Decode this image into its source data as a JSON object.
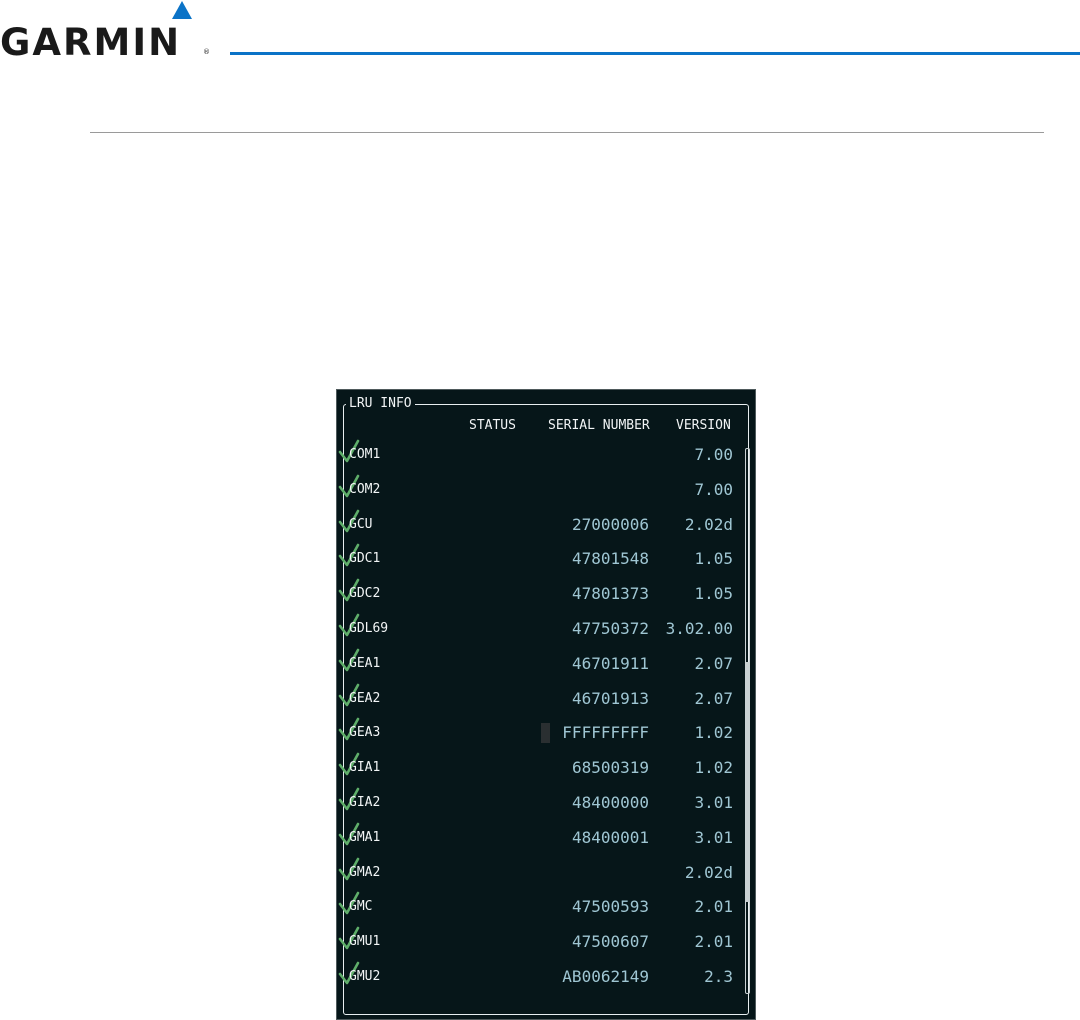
{
  "brand": {
    "name": "GARMIN",
    "mark": "®",
    "logo_color": "#0b73c7"
  },
  "panel": {
    "title": "LRU INFO",
    "columns": {
      "status": "STATUS",
      "serial": "SERIAL NUMBER",
      "version": "VERSION"
    },
    "status_icon": "check-mark-icon",
    "status_color": "#5fae6a",
    "rows": [
      {
        "name": "COM1",
        "status": "ok",
        "serial": "",
        "version": "7.00"
      },
      {
        "name": "COM2",
        "status": "ok",
        "serial": "",
        "version": "7.00"
      },
      {
        "name": "GCU",
        "status": "ok",
        "serial": "27000006",
        "version": "2.02d"
      },
      {
        "name": "GDC1",
        "status": "ok",
        "serial": "47801548",
        "version": "1.05"
      },
      {
        "name": "GDC2",
        "status": "ok",
        "serial": "47801373",
        "version": "1.05"
      },
      {
        "name": "GDL69",
        "status": "ok",
        "serial": "47750372",
        "version": "3.02.00"
      },
      {
        "name": "GEA1",
        "status": "ok",
        "serial": "46701911",
        "version": "2.07"
      },
      {
        "name": "GEA2",
        "status": "ok",
        "serial": "46701913",
        "version": "2.07"
      },
      {
        "name": "GEA3",
        "status": "ok",
        "serial": "FFFFFFFFF",
        "version": "1.02"
      },
      {
        "name": "GIA1",
        "status": "ok",
        "serial": "68500319",
        "version": "1.02"
      },
      {
        "name": "GIA2",
        "status": "ok",
        "serial": "48400000",
        "version": "3.01"
      },
      {
        "name": "GMA1",
        "status": "ok",
        "serial": "48400001",
        "version": "3.01"
      },
      {
        "name": "GMA2",
        "status": "ok",
        "serial": "",
        "version": "2.02d"
      },
      {
        "name": "GMC",
        "status": "ok",
        "serial": "47500593",
        "version": "2.01"
      },
      {
        "name": "GMU1",
        "status": "ok",
        "serial": "47500607",
        "version": "2.01"
      },
      {
        "name": "GMU2",
        "status": "ok",
        "serial": "AB0062149",
        "version": "2.3"
      }
    ]
  },
  "scroll": {
    "position_fraction": 0.7
  }
}
